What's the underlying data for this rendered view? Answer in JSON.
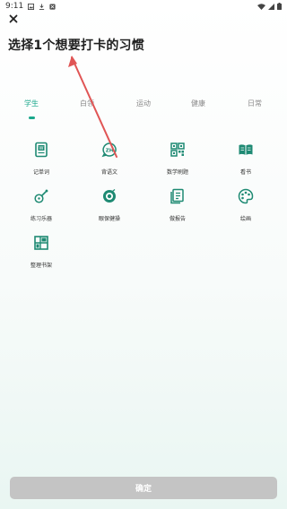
{
  "status_bar": {
    "time": "9:11",
    "left_icons": [
      "gallery-icon",
      "download-icon",
      "app-icon"
    ],
    "right_icons": [
      "wifi-icon",
      "signal-icon",
      "battery-icon"
    ]
  },
  "header": {
    "close_icon": "close-icon",
    "title": "选择1个想要打卡的习惯"
  },
  "tabs": [
    {
      "label": "学生",
      "active": true
    },
    {
      "label": "白领",
      "active": false
    },
    {
      "label": "运动",
      "active": false
    },
    {
      "label": "健康",
      "active": false
    },
    {
      "label": "日常",
      "active": false
    }
  ],
  "habits": [
    {
      "label": "记单词",
      "icon": "word-card-icon"
    },
    {
      "label": "背语文",
      "icon": "chinese-chat-icon"
    },
    {
      "label": "数学刷题",
      "icon": "qr-grid-icon"
    },
    {
      "label": "看书",
      "icon": "open-book-icon"
    },
    {
      "label": "练习乐器",
      "icon": "guitar-icon"
    },
    {
      "label": "眼保健操",
      "icon": "eye-icon"
    },
    {
      "label": "做报告",
      "icon": "report-icon"
    },
    {
      "label": "绘画",
      "icon": "palette-icon"
    },
    {
      "label": "整理书架",
      "icon": "bookshelf-icon"
    }
  ],
  "footer": {
    "confirm_label": "确定"
  },
  "colors": {
    "accent": "#1aa88c",
    "annotation_arrow": "#e05555",
    "button_disabled": "#c4c4c4"
  }
}
